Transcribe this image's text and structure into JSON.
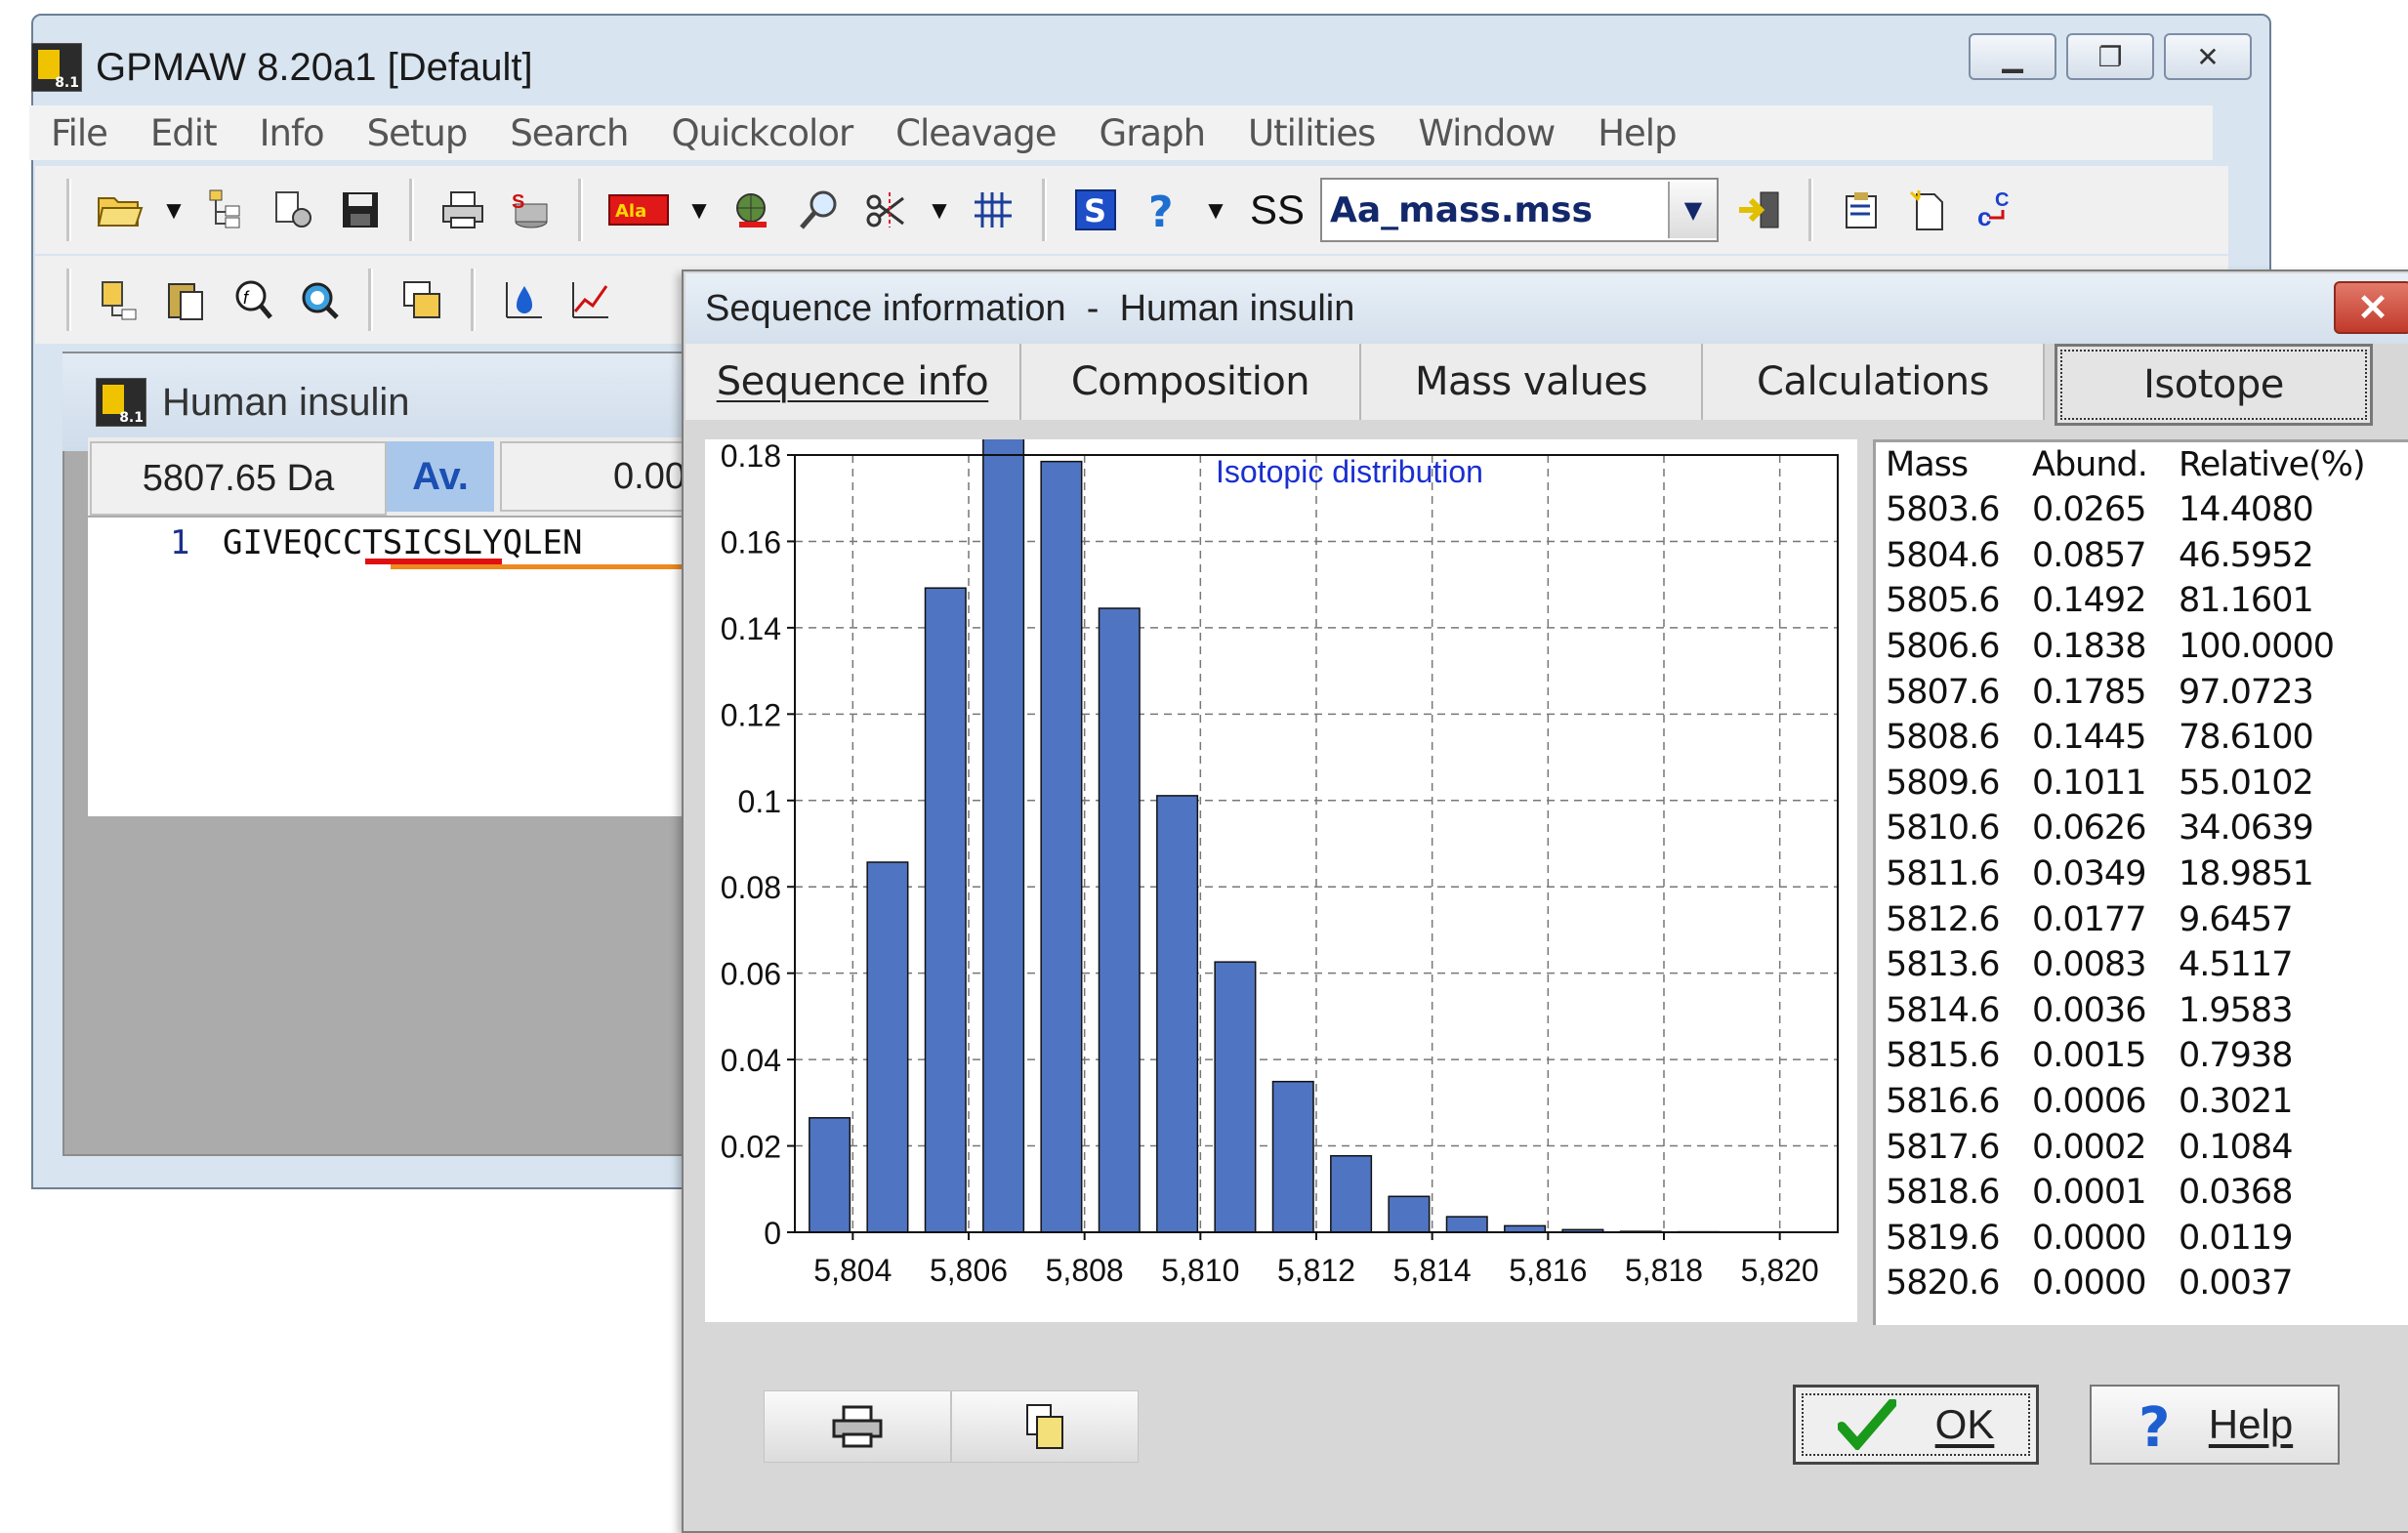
{
  "app": {
    "title": "GPMAW 8.20a1  [Default]",
    "window_buttons": [
      "▁",
      "❐",
      "✕"
    ]
  },
  "menu": [
    "File",
    "Edit",
    "Info",
    "Setup",
    "Search",
    "Quickcolor",
    "Cleavage",
    "Graph",
    "Utilities",
    "Window",
    "Help"
  ],
  "toolbar": {
    "ss_label": "SS",
    "style_file": "Aa_mass.mss",
    "ala_label": "Ala",
    "s_label": "S",
    "help_glyph": "?"
  },
  "seq_window": {
    "title": "Human insulin",
    "mass": "5807.65 Da",
    "mass_type": "Av.",
    "value": "0.00",
    "line_number": "1",
    "sequence": "GIVEQCCTSICSLYQLEN"
  },
  "dialog": {
    "title": "Sequence information  -  Human insulin",
    "close": "✕",
    "tabs": [
      "Sequence info",
      "Composition",
      "Mass values",
      "Calculations",
      "Isotope"
    ],
    "active_tab": "Isotope",
    "ok_label": "OK",
    "help_label": "Help"
  },
  "chart_data": {
    "type": "bar",
    "title": "Isotopic distribution",
    "xlabel": "",
    "ylabel": "",
    "x": [
      5803.6,
      5804.6,
      5805.6,
      5806.6,
      5807.6,
      5808.6,
      5809.6,
      5810.6,
      5811.6,
      5812.6,
      5813.6,
      5814.6,
      5815.6,
      5816.6,
      5817.6,
      5818.6,
      5819.6,
      5820.6
    ],
    "values": [
      0.0265,
      0.0857,
      0.1492,
      0.1838,
      0.1785,
      0.1445,
      0.1011,
      0.0626,
      0.0349,
      0.0177,
      0.0083,
      0.0036,
      0.0015,
      0.0006,
      0.0002,
      0.0001,
      0.0,
      0.0
    ],
    "xlim": [
      5803,
      5821
    ],
    "ylim": [
      0,
      0.18
    ],
    "x_ticks": [
      "5,804",
      "5,806",
      "5,808",
      "5,810",
      "5,812",
      "5,814",
      "5,816",
      "5,818",
      "5,820"
    ],
    "x_tick_values": [
      5804,
      5806,
      5808,
      5810,
      5812,
      5814,
      5816,
      5818,
      5820
    ],
    "y_ticks": [
      "0",
      "0.02",
      "0.04",
      "0.06",
      "0.08",
      "0.1",
      "0.12",
      "0.14",
      "0.16",
      "0.18"
    ],
    "y_tick_values": [
      0,
      0.02,
      0.04,
      0.06,
      0.08,
      0.1,
      0.12,
      0.14,
      0.16,
      0.18
    ],
    "grid": true,
    "bar_color": "#4f74c2",
    "title_color": "#1a2fd0"
  },
  "isotope_table": {
    "headers": [
      "Mass",
      "Abund.",
      "Relative(%)"
    ],
    "rows": [
      [
        "5803.6",
        "0.0265",
        "14.4080"
      ],
      [
        "5804.6",
        "0.0857",
        "46.5952"
      ],
      [
        "5805.6",
        "0.1492",
        "81.1601"
      ],
      [
        "5806.6",
        "0.1838",
        "100.0000"
      ],
      [
        "5807.6",
        "0.1785",
        "97.0723"
      ],
      [
        "5808.6",
        "0.1445",
        "78.6100"
      ],
      [
        "5809.6",
        "0.1011",
        "55.0102"
      ],
      [
        "5810.6",
        "0.0626",
        "34.0639"
      ],
      [
        "5811.6",
        "0.0349",
        "18.9851"
      ],
      [
        "5812.6",
        "0.0177",
        "9.6457"
      ],
      [
        "5813.6",
        "0.0083",
        "4.5117"
      ],
      [
        "5814.6",
        "0.0036",
        "1.9583"
      ],
      [
        "5815.6",
        "0.0015",
        "0.7938"
      ],
      [
        "5816.6",
        "0.0006",
        "0.3021"
      ],
      [
        "5817.6",
        "0.0002",
        "0.1084"
      ],
      [
        "5818.6",
        "0.0001",
        "0.0368"
      ],
      [
        "5819.6",
        "0.0000",
        "0.0119"
      ],
      [
        "5820.6",
        "0.0000",
        "0.0037"
      ]
    ]
  }
}
